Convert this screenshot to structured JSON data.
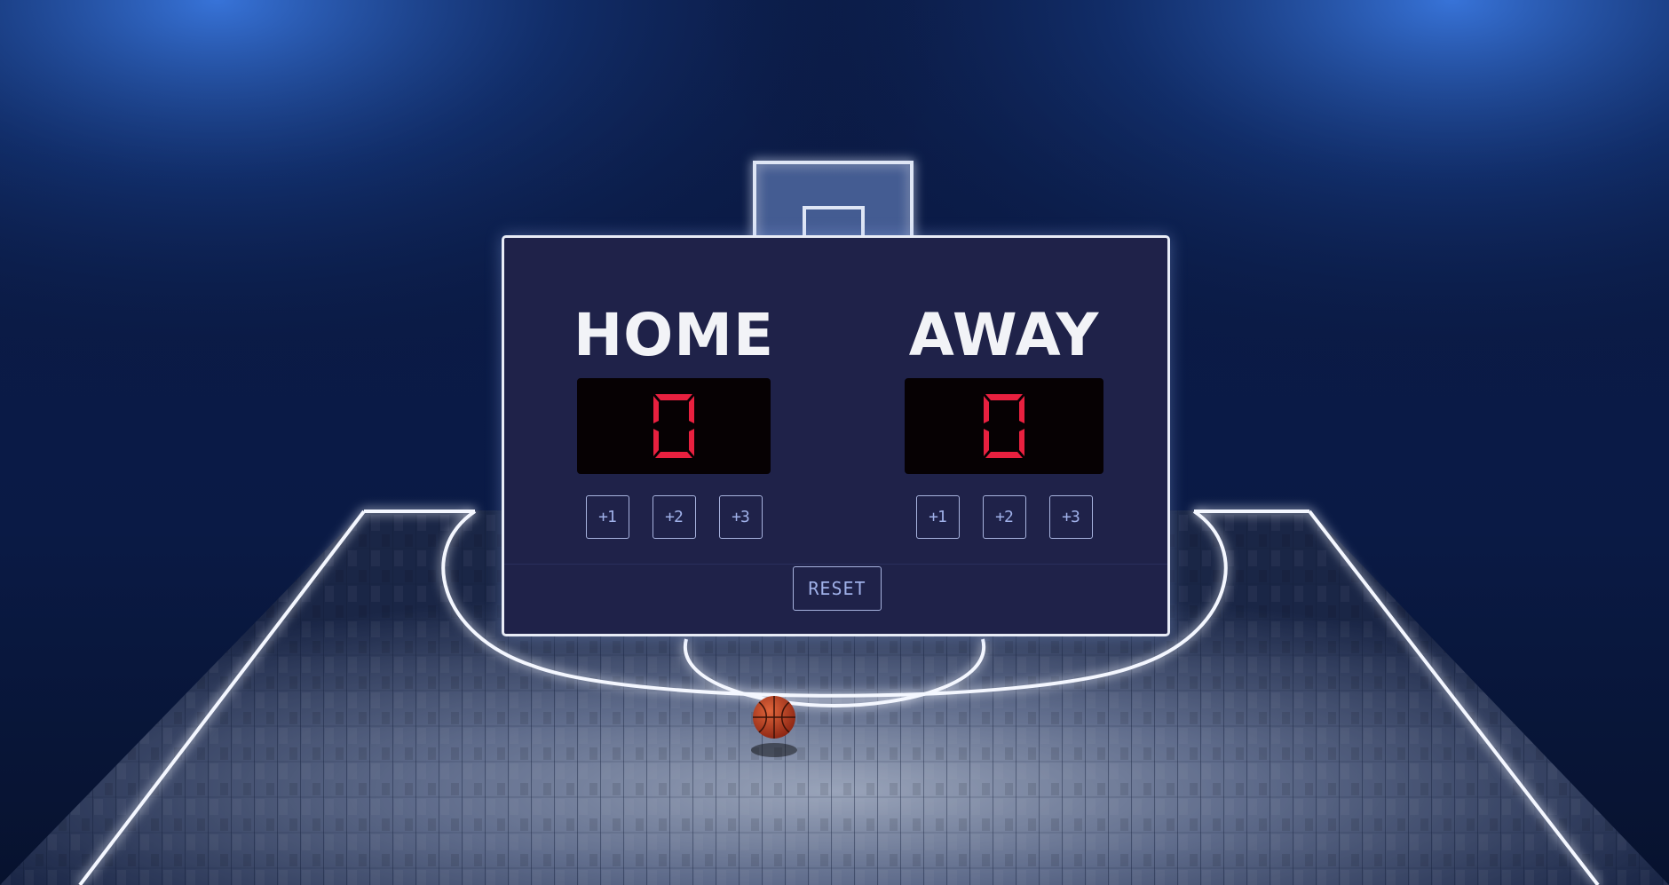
{
  "scoreboard": {
    "home": {
      "label": "HOME",
      "score": "0",
      "buttons": [
        "+1",
        "+2",
        "+3"
      ]
    },
    "away": {
      "label": "AWAY",
      "score": "0",
      "buttons": [
        "+1",
        "+2",
        "+3"
      ]
    },
    "reset_label": "RESET"
  },
  "colors": {
    "board_bg": "#1f2249",
    "score_digit": "#e8203f",
    "display_bg": "#060103",
    "button_text": "#9fb0e8"
  },
  "icons": [
    "basketball-icon"
  ]
}
